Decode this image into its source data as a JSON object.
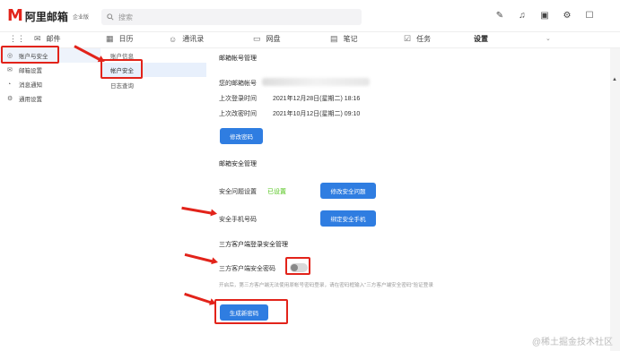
{
  "header": {
    "logo_mark": "M",
    "logo_text": "阿里邮箱",
    "logo_badge": "企业版",
    "search_placeholder": "搜索",
    "icons": [
      "pen-icon",
      "bell-icon",
      "calendar-icon",
      "gear-icon",
      "message-icon"
    ]
  },
  "nav": {
    "items": [
      {
        "label": "邮件",
        "icon": "mail-icon"
      },
      {
        "label": "日历",
        "icon": "calendar-icon"
      },
      {
        "label": "通讯录",
        "icon": "contacts-icon"
      },
      {
        "label": "网盘",
        "icon": "folder-icon"
      },
      {
        "label": "笔记",
        "icon": "note-icon"
      },
      {
        "label": "任务",
        "icon": "task-icon"
      },
      {
        "label": "设置",
        "icon": "settings-icon"
      }
    ]
  },
  "sidebar": {
    "items": [
      {
        "label": "账户与安全",
        "icon": "user-icon"
      },
      {
        "label": "邮箱设置",
        "icon": "mail-icon"
      },
      {
        "label": "消息通知",
        "icon": "bell-icon"
      },
      {
        "label": "通用设置",
        "icon": "gear-icon"
      }
    ]
  },
  "subnav": {
    "items": [
      {
        "label": "账户信息"
      },
      {
        "label": "帐户安全"
      },
      {
        "label": "日志查询"
      }
    ]
  },
  "main": {
    "account_section": "邮箱帐号管理",
    "your_account_label": "您的邮箱帐号",
    "last_login_label": "上次登录时间",
    "last_login_value": "2021年12月28日(星期二) 18:16",
    "last_change_label": "上次改密时间",
    "last_change_value": "2021年10月12日(星期二) 09:10",
    "change_password_btn": "修改密码",
    "security_section": "邮箱安全管理",
    "security_question_label": "安全问题设置",
    "security_question_status": "已设置",
    "change_question_btn": "修改安全问题",
    "phone_label": "安全手机号码",
    "bind_phone_btn": "绑定安全手机",
    "third_party_section": "三方客户端登录安全管理",
    "third_party_pwd_label": "三方客户端安全密码",
    "hint": "开启后，第三方客户端无法使用原帐号密码登录，请在密码框输入\"三方客户端安全密码\"验证登录",
    "generate_btn": "生成新密码",
    "third_party_enabled": false
  },
  "watermark": "@稀土掘金技术社区",
  "colors": {
    "accent": "#2f7de1",
    "brand": "#e2231a",
    "success": "#52c41a"
  }
}
